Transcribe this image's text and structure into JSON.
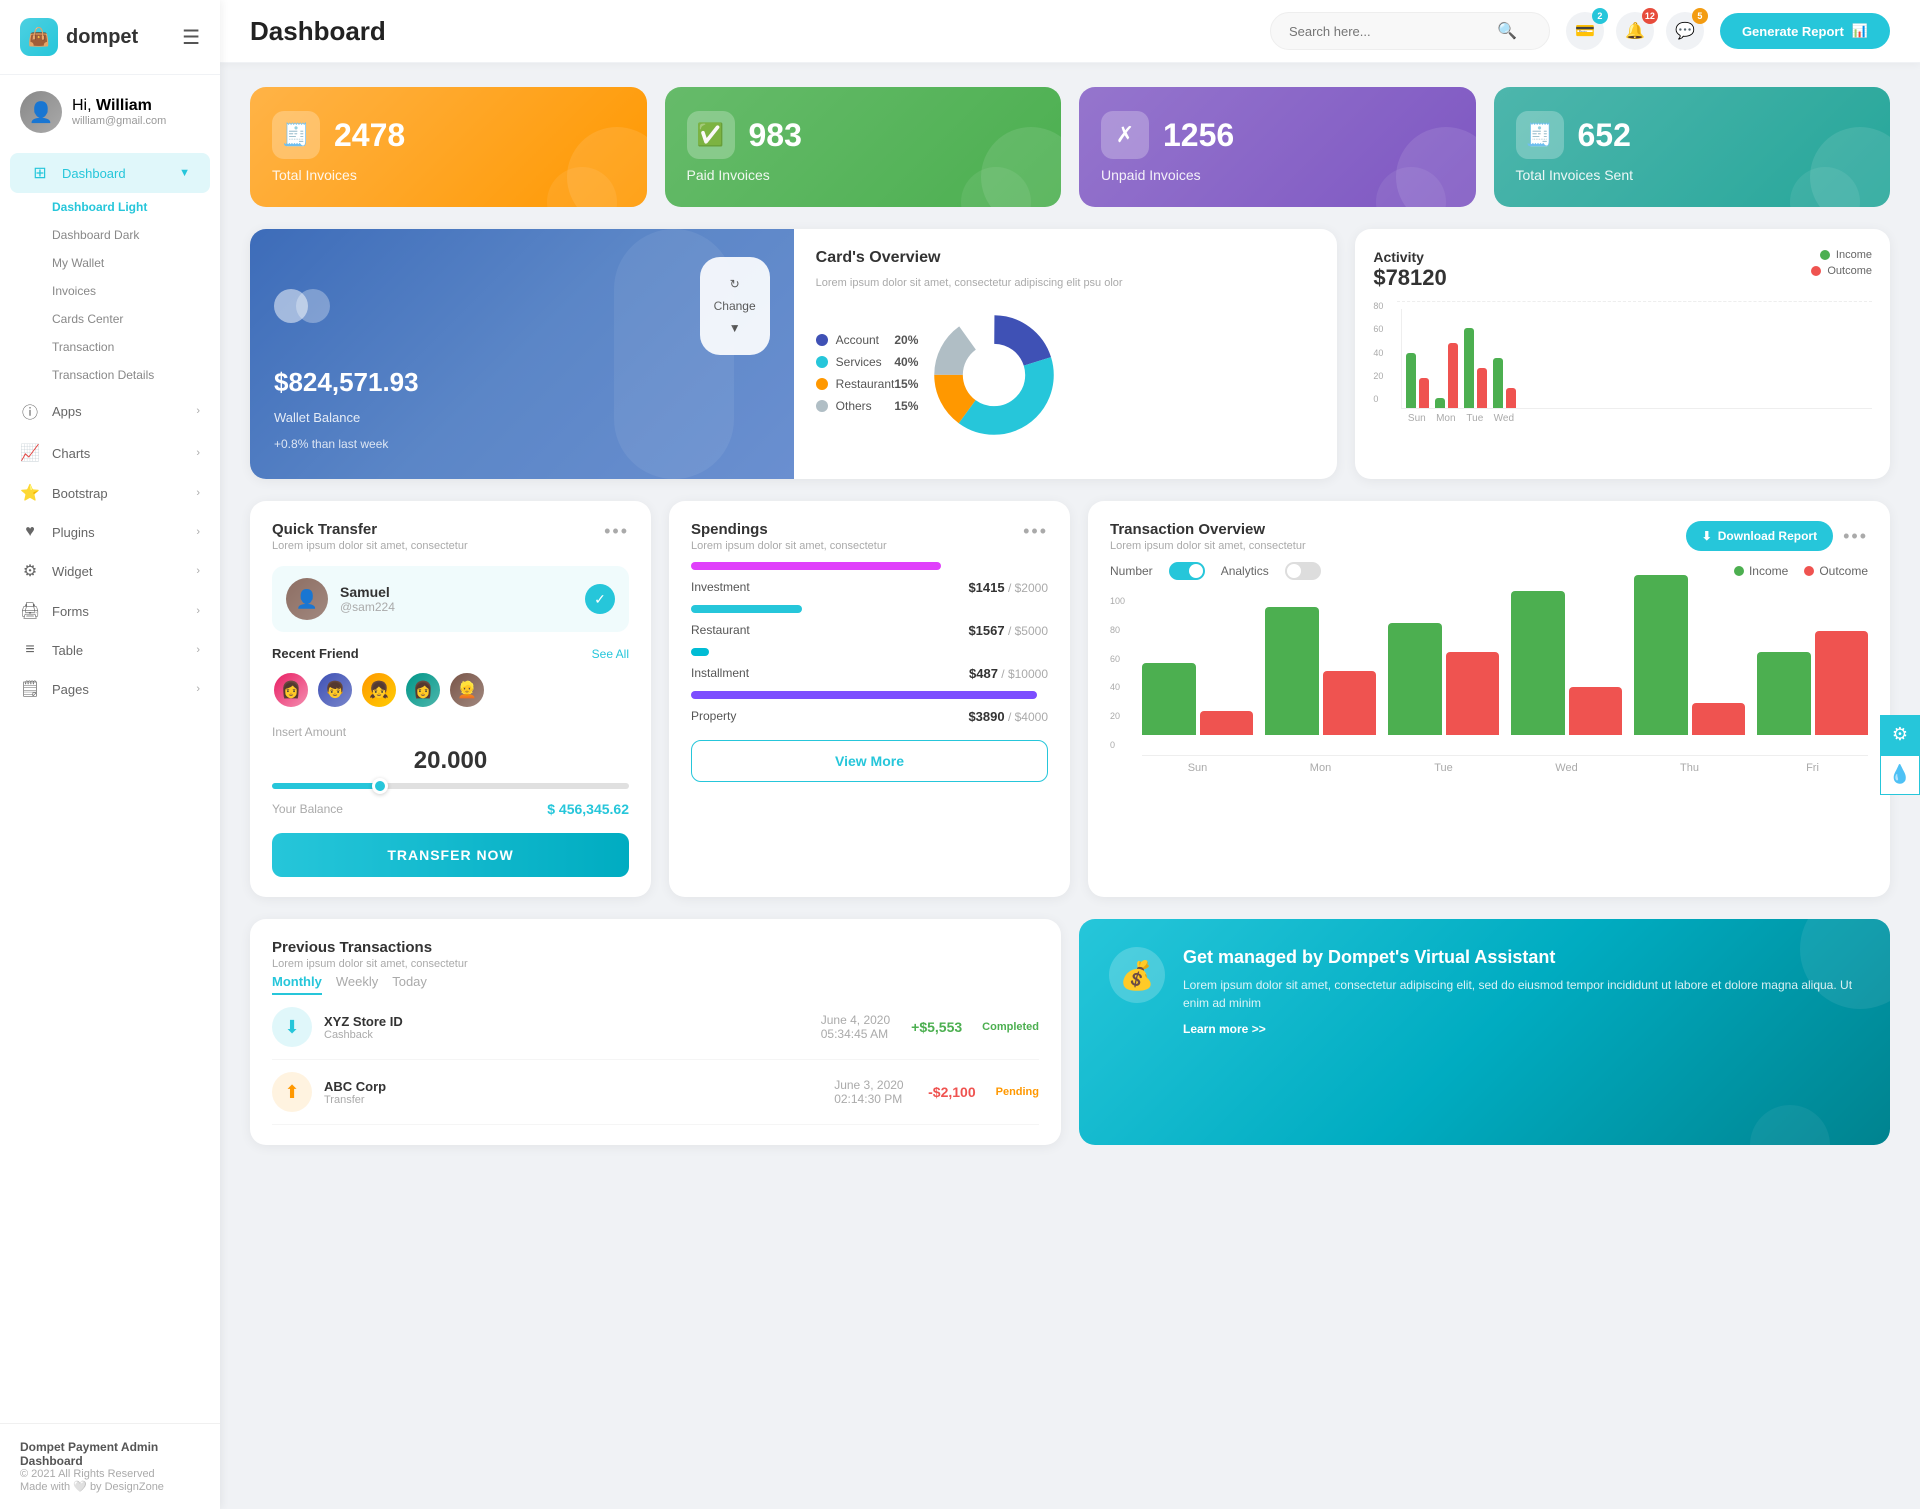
{
  "app": {
    "name": "dompet",
    "logo_emoji": "👜"
  },
  "header": {
    "title": "Dashboard",
    "search_placeholder": "Search here...",
    "generate_btn": "Generate Report",
    "icon_badges": {
      "wallet": "2",
      "bell": "12",
      "chat": "5"
    }
  },
  "user": {
    "greeting": "Hi,",
    "name": "William",
    "email": "william@gmail.com",
    "avatar_emoji": "👤"
  },
  "sidebar": {
    "nav_items": [
      {
        "id": "dashboard",
        "label": "Dashboard",
        "icon": "⊞",
        "active": true,
        "has_arrow": true
      },
      {
        "id": "apps",
        "label": "Apps",
        "icon": "ⓘ",
        "active": false,
        "has_arrow": true
      },
      {
        "id": "charts",
        "label": "Charts",
        "icon": "📈",
        "active": false,
        "has_arrow": true
      },
      {
        "id": "bootstrap",
        "label": "Bootstrap",
        "icon": "⭐",
        "active": false,
        "has_arrow": true
      },
      {
        "id": "plugins",
        "label": "Plugins",
        "icon": "❤",
        "active": false,
        "has_arrow": true
      },
      {
        "id": "widget",
        "label": "Widget",
        "icon": "⚙",
        "active": false,
        "has_arrow": true
      },
      {
        "id": "forms",
        "label": "Forms",
        "icon": "🖨",
        "active": false,
        "has_arrow": true
      },
      {
        "id": "table",
        "label": "Table",
        "icon": "≡",
        "active": false,
        "has_arrow": true
      },
      {
        "id": "pages",
        "label": "Pages",
        "icon": "🗒",
        "active": false,
        "has_arrow": true
      }
    ],
    "sub_items": [
      {
        "id": "dashboard-light",
        "label": "Dashboard Light",
        "active": true
      },
      {
        "id": "dashboard-dark",
        "label": "Dashboard Dark",
        "active": false
      },
      {
        "id": "my-wallet",
        "label": "My Wallet",
        "active": false
      },
      {
        "id": "invoices",
        "label": "Invoices",
        "active": false
      },
      {
        "id": "cards-center",
        "label": "Cards Center",
        "active": false
      },
      {
        "id": "transaction",
        "label": "Transaction",
        "active": false
      },
      {
        "id": "transaction-details",
        "label": "Transaction Details",
        "active": false
      }
    ],
    "footer": {
      "brand": "Dompet Payment Admin Dashboard",
      "year": "© 2021 All Rights Reserved",
      "credit": "Made with 🤍 by DesignZone"
    }
  },
  "stats": [
    {
      "id": "total-invoices",
      "number": "2478",
      "label": "Total Invoices",
      "color": "orange",
      "icon": "🧾"
    },
    {
      "id": "paid-invoices",
      "number": "983",
      "label": "Paid Invoices",
      "color": "green",
      "icon": "✅"
    },
    {
      "id": "unpaid-invoices",
      "number": "1256",
      "label": "Unpaid Invoices",
      "color": "purple",
      "icon": "✗"
    },
    {
      "id": "total-sent",
      "number": "652",
      "label": "Total Invoices Sent",
      "color": "teal",
      "icon": "🧾"
    }
  ],
  "wallet": {
    "amount": "$824,571.93",
    "label": "Wallet Balance",
    "growth": "+0.8% than last week",
    "change_btn": "Change"
  },
  "cards_overview": {
    "title": "Card's Overview",
    "desc": "Lorem ipsum dolor sit amet, consectetur adipiscing elit psu olor",
    "items": [
      {
        "label": "Account",
        "pct": "20%",
        "color": "#3f51b5"
      },
      {
        "label": "Services",
        "pct": "40%",
        "color": "#26c6da"
      },
      {
        "label": "Restaurant",
        "pct": "15%",
        "color": "#ff9800"
      },
      {
        "label": "Others",
        "pct": "15%",
        "color": "#b0bec5"
      }
    ]
  },
  "activity": {
    "title": "Activity",
    "amount": "$78120",
    "legend": [
      {
        "label": "Income",
        "color": "#4caf50"
      },
      {
        "label": "Outcome",
        "color": "#ef5350"
      }
    ],
    "bars": [
      {
        "day": "Sun",
        "income": 55,
        "outcome": 30
      },
      {
        "day": "Mon",
        "income": 10,
        "outcome": 65
      },
      {
        "day": "Tue",
        "income": 80,
        "outcome": 40
      },
      {
        "day": "Wed",
        "income": 50,
        "outcome": 20
      }
    ],
    "y_labels": [
      "80",
      "60",
      "40",
      "20",
      "0"
    ]
  },
  "quick_transfer": {
    "title": "Quick Transfer",
    "desc": "Lorem ipsum dolor sit amet, consectetur",
    "user": {
      "name": "Samuel",
      "handle": "@sam224",
      "avatar_emoji": "👤"
    },
    "recent_friend_label": "Recent Friend",
    "see_more": "See All",
    "friends": [
      "👩",
      "👦",
      "👧",
      "👩",
      "👱"
    ],
    "insert_amount_label": "Insert Amount",
    "amount": "20.000",
    "your_balance_label": "Your Balance",
    "balance": "$ 456,345.62",
    "transfer_btn": "TRANSFER NOW"
  },
  "spendings": {
    "title": "Spendings",
    "desc": "Lorem ipsum dolor sit amet, consectetur",
    "items": [
      {
        "label": "Investment",
        "amount": "$1415",
        "max": "$2000",
        "pct": 70,
        "color": "#e040fb"
      },
      {
        "label": "Restaurant",
        "amount": "$1567",
        "max": "$5000",
        "pct": 31,
        "color": "#26c6da"
      },
      {
        "label": "Installment",
        "amount": "$487",
        "max": "$10000",
        "pct": 5,
        "color": "#00bcd4"
      },
      {
        "label": "Property",
        "amount": "$3890",
        "max": "$4000",
        "pct": 97,
        "color": "#7c4dff"
      }
    ],
    "view_more_btn": "View More"
  },
  "transaction_overview": {
    "title": "Transaction Overview",
    "desc": "Lorem ipsum dolor sit amet, consectetur",
    "download_btn": "Download Report",
    "toggles": [
      {
        "label": "Number",
        "on": true
      },
      {
        "label": "Analytics",
        "on": false
      }
    ],
    "legend": [
      {
        "label": "Income",
        "color": "#4caf50"
      },
      {
        "label": "Outcome",
        "color": "#ef5350"
      }
    ],
    "bars": [
      {
        "day": "Sun",
        "income": 45,
        "outcome": 15
      },
      {
        "day": "Mon",
        "income": 80,
        "outcome": 40
      },
      {
        "day": "Tue",
        "income": 70,
        "outcome": 52
      },
      {
        "day": "Wed",
        "income": 90,
        "outcome": 30
      },
      {
        "day": "Thu",
        "income": 100,
        "outcome": 20
      },
      {
        "day": "Fri",
        "income": 52,
        "outcome": 65
      }
    ],
    "y_labels": [
      "100",
      "80",
      "60",
      "40",
      "20",
      "0"
    ]
  },
  "prev_transactions": {
    "title": "Previous Transactions",
    "desc": "Lorem ipsum dolor sit amet, consectetur",
    "tabs": [
      "Monthly",
      "Weekly",
      "Today"
    ],
    "active_tab": "Monthly",
    "items": [
      {
        "name": "XYZ Store ID",
        "type": "Cashback",
        "date": "June 4, 2020",
        "time": "05:34:45 AM",
        "amount": "+$5,553",
        "status": "Completed",
        "icon": "⬇",
        "icon_color": "#4caf50"
      }
    ]
  },
  "virtual_assistant": {
    "title": "Get managed by Dompet's Virtual Assistant",
    "desc": "Lorem ipsum dolor sit amet, consectetur adipiscing elit, sed do eiusmod tempor incididunt ut labore et dolore magna aliqua. Ut enim ad minim",
    "link": "Learn more >>"
  }
}
